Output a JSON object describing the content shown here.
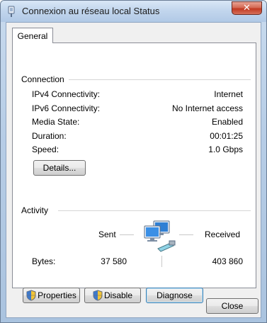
{
  "window": {
    "title": "Connexion au réseau local Status",
    "close_label": "✕"
  },
  "tabs": [
    {
      "label": "General"
    }
  ],
  "connection": {
    "group_title": "Connection",
    "rows": [
      {
        "label": "IPv4 Connectivity:",
        "value": "Internet"
      },
      {
        "label": "IPv6 Connectivity:",
        "value": "No Internet access"
      },
      {
        "label": "Media State:",
        "value": "Enabled"
      },
      {
        "label": "Duration:",
        "value": "00:01:25"
      },
      {
        "label": "Speed:",
        "value": "1.0 Gbps"
      }
    ],
    "details_label": "Details..."
  },
  "activity": {
    "group_title": "Activity",
    "sent_label": "Sent",
    "received_label": "Received",
    "bytes_label": "Bytes:",
    "bytes_sent": "37 580",
    "bytes_received": "403 860",
    "icon": "network-computers-icon"
  },
  "actions": {
    "properties_label": "Properties",
    "disable_label": "Disable",
    "diagnose_label": "Diagnose"
  },
  "footer": {
    "close_label": "Close"
  },
  "colors": {
    "accent": "#3c7fb1",
    "titlebar": "#c2d6ed",
    "close_red": "#c23a22"
  }
}
